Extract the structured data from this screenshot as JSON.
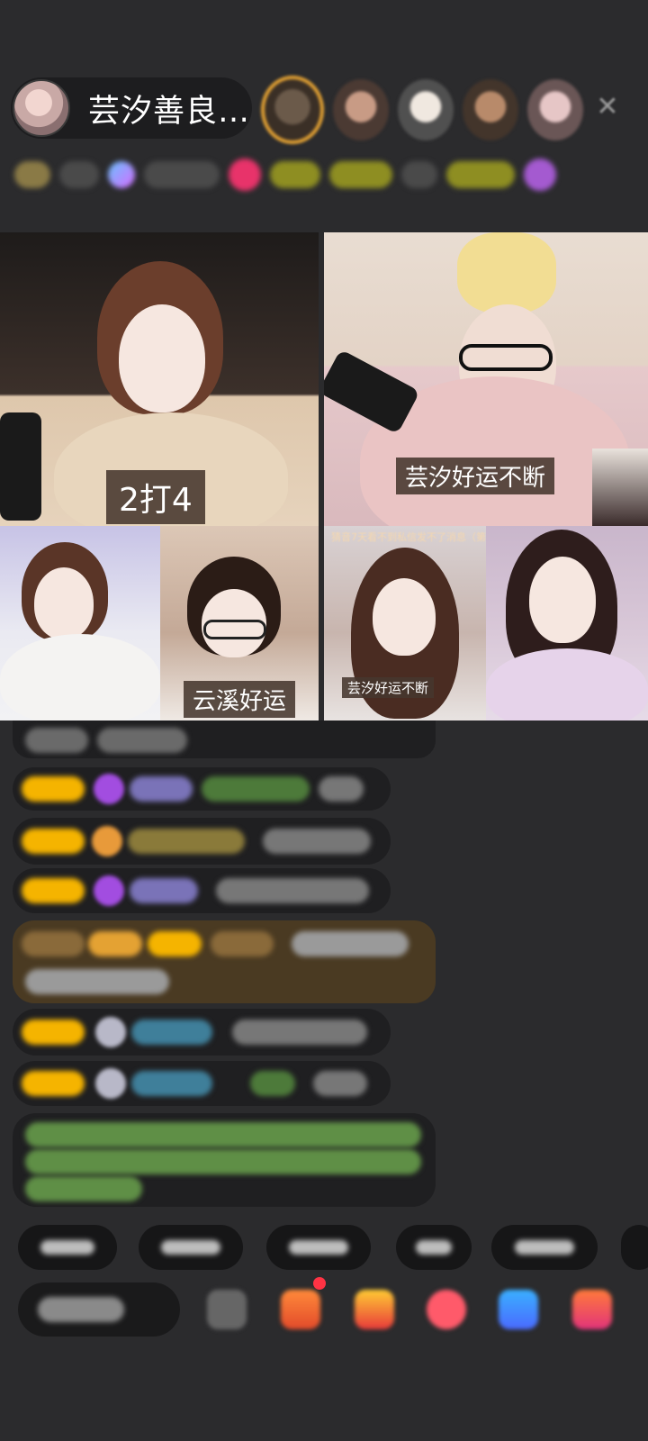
{
  "host": {
    "name": "芸汐善良…"
  },
  "video_tiles": [
    {
      "caption": "2打4"
    },
    {
      "caption": "芸汐好运不断"
    },
    {
      "caption": ""
    },
    {
      "caption": "云溪好运"
    },
    {
      "caption": "芸汐好运不断",
      "ticker": "猜音7天看不到私信发不了消息（第3天）"
    },
    {
      "caption": ""
    }
  ],
  "colors": {
    "background": "#2b2b2d",
    "chat_bubble": "#1f1f21",
    "highlight_bubble": "#4a3a22",
    "level_badge": "#f5b400",
    "system_text": "#7fcf6a",
    "notification": "#ff3344"
  },
  "icons": {
    "close": "close-icon",
    "purple_gem": "gem-icon",
    "orange_medal": "medal-icon",
    "gift": "gift-icon",
    "more": "more-icon"
  }
}
